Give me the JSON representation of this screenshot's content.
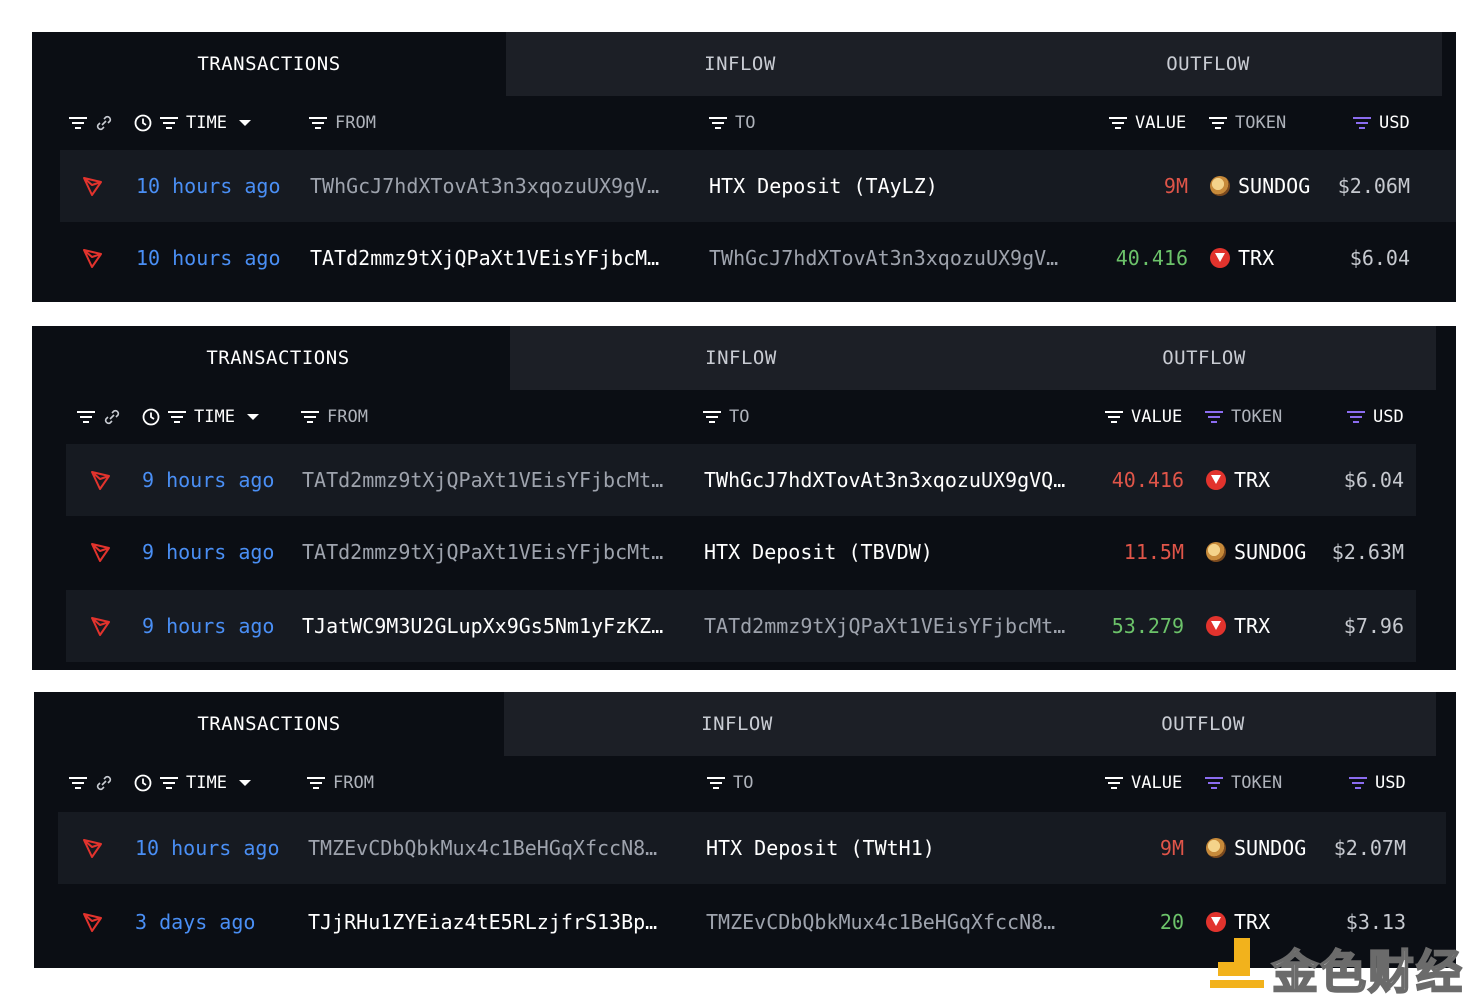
{
  "headers": {
    "time": "TIME",
    "from": "FROM",
    "to": "TO",
    "value": "VALUE",
    "token": "TOKEN",
    "usd": "USD"
  },
  "panels": [
    {
      "tabs": [
        "TRANSACTIONS",
        "INFLOW",
        "OUTFLOW"
      ],
      "rows": [
        {
          "time": "10 hours ago",
          "from": "TWhGcJ7hdXTovAt3n3xqozuUX9gV…",
          "to": "HTX Deposit (TAyLZ)",
          "value": "9M",
          "token": "SUNDOG",
          "usd": "$2.06M"
        },
        {
          "time": "10 hours ago",
          "from": "TATd2mmz9tXjQPaXt1VEisYFjbcM…",
          "to": "TWhGcJ7hdXTovAt3n3xqozuUX9gV…",
          "value": "40.416",
          "token": "TRX",
          "usd": "$6.04"
        }
      ]
    },
    {
      "tabs": [
        "TRANSACTIONS",
        "INFLOW",
        "OUTFLOW"
      ],
      "rows": [
        {
          "time": "9 hours ago",
          "from": "TATd2mmz9tXjQPaXt1VEisYFjbcMt…",
          "to": "TWhGcJ7hdXTovAt3n3xqozuUX9gVQ…",
          "value": "40.416",
          "token": "TRX",
          "usd": "$6.04"
        },
        {
          "time": "9 hours ago",
          "from": "TATd2mmz9tXjQPaXt1VEisYFjbcMt…",
          "to": "HTX Deposit (TBVDW)",
          "value": "11.5M",
          "token": "SUNDOG",
          "usd": "$2.63M"
        },
        {
          "time": "9 hours ago",
          "from": "TJatWC9M3U2GLupXx9Gs5Nm1yFzKZ…",
          "to": "TATd2mmz9tXjQPaXt1VEisYFjbcMt…",
          "value": "53.279",
          "token": "TRX",
          "usd": "$7.96"
        }
      ]
    },
    {
      "tabs": [
        "TRANSACTIONS",
        "INFLOW",
        "OUTFLOW"
      ],
      "rows": [
        {
          "time": "10 hours ago",
          "from": "TMZEvCDbQbkMux4c1BeHGqXfccN8…",
          "to": "HTX Deposit (TWtH1)",
          "value": "9M",
          "token": "SUNDOG",
          "usd": "$2.07M"
        },
        {
          "time": "3 days ago",
          "from": "TJjRHu1ZYEiaz4tE5RLzjfrS13Bp…",
          "to": "TMZEvCDbQbkMux4c1BeHGqXfccN8…",
          "value": "20",
          "token": "TRX",
          "usd": "$3.13"
        }
      ]
    }
  ],
  "watermark": "金色财经",
  "colors": {
    "background": "#0b0e14",
    "tab_inactive": "#1c1f26",
    "row_stripe": "#161a21",
    "time_link": "#4a8ff5",
    "value_red": "#e05549",
    "value_green": "#6cc36a",
    "tron_red": "#e2332d",
    "token_filter_purple": "#8b6cf0"
  },
  "icons": [
    "filter-icon",
    "link-icon",
    "clock-icon",
    "caret-down-icon",
    "tron-logo-icon",
    "trx-coin-icon",
    "sundog-coin-icon"
  ]
}
